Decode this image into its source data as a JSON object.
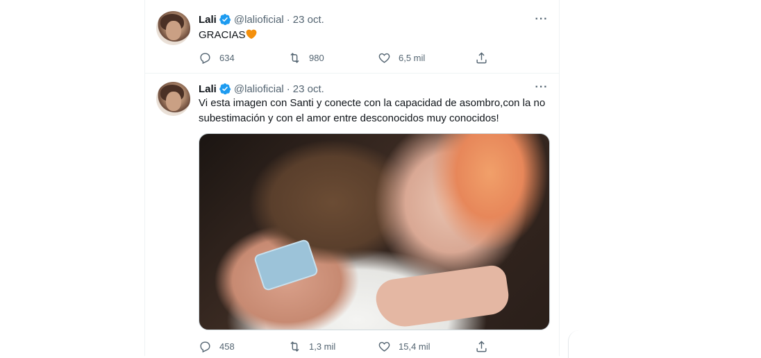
{
  "tweets": [
    {
      "author_name": "Lali",
      "handle": "@lalioficial",
      "separator": "·",
      "date": "23 oct.",
      "text": "GRACIAS",
      "emoji": "orange-heart",
      "replies": "634",
      "retweets": "980",
      "likes": "6,5 mil"
    },
    {
      "author_name": "Lali",
      "handle": "@lalioficial",
      "separator": "·",
      "date": "23 oct.",
      "text": "Vi esta imagen con Santi y conecte con la capacidad de asombro,con la no subestimación y con el amor entre desconocidos muy conocidos!",
      "replies": "458",
      "retweets": "1,3 mil",
      "likes": "15,4 mil"
    }
  ],
  "icons": {
    "more": "more-icon",
    "reply": "reply-icon",
    "retweet": "retweet-icon",
    "like": "heart-icon",
    "share": "share-icon",
    "verified": "verified-badge-icon"
  },
  "colors": {
    "verified": "#1d9bf0",
    "secondary_text": "#536471",
    "emoji_heart": "#f4900c"
  }
}
